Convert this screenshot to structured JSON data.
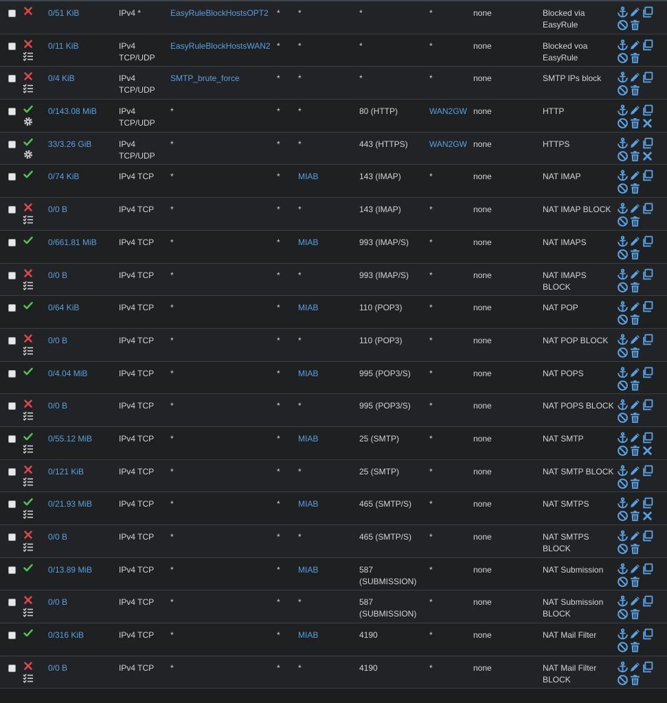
{
  "colors": {
    "link": "#5aa0e0",
    "pass": "#4fc44f",
    "block": "#e04848",
    "icon": "#5aa0e0"
  },
  "rules": [
    {
      "action": "block",
      "sub": "",
      "states": "0/51 KiB",
      "protocol": "IPv4 *",
      "source": "EasyRuleBlockHostsOPT2",
      "source_port": "*",
      "destination": "*",
      "dest_port": "*",
      "gateway": "*",
      "queue": "none",
      "description": "Blocked via EasyRule",
      "extra_x": false
    },
    {
      "action": "block",
      "sub": "list",
      "states": "0/11 KiB",
      "protocol": "IPv4 TCP/UDP",
      "source": "EasyRuleBlockHostsWAN2",
      "source_port": "*",
      "destination": "*",
      "dest_port": "*",
      "gateway": "*",
      "queue": "none",
      "description": "Blocked voa EasyRule",
      "extra_x": false
    },
    {
      "action": "block",
      "sub": "list",
      "states": "0/4 KiB",
      "protocol": "IPv4 TCP/UDP",
      "source": "SMTP_brute_force",
      "source_port": "*",
      "destination": "*",
      "dest_port": "*",
      "gateway": "*",
      "queue": "none",
      "description": "SMTP IPs block",
      "extra_x": false
    },
    {
      "action": "pass",
      "sub": "gear",
      "states": "0/143.08 MiB",
      "protocol": "IPv4 TCP/UDP",
      "source": "*",
      "source_port": "*",
      "destination": "*",
      "dest_port": "80 (HTTP)",
      "gateway": "WAN2GW",
      "queue": "none",
      "description": "HTTP",
      "extra_x": true
    },
    {
      "action": "pass",
      "sub": "gear",
      "states": "33/3.26 GiB",
      "protocol": "IPv4 TCP/UDP",
      "source": "*",
      "source_port": "*",
      "destination": "*",
      "dest_port": "443 (HTTPS)",
      "gateway": "WAN2GW",
      "queue": "none",
      "description": "HTTPS",
      "extra_x": true
    },
    {
      "action": "pass",
      "sub": "",
      "states": "0/74 KiB",
      "protocol": "IPv4 TCP",
      "source": "*",
      "source_port": "*",
      "destination": "MIAB",
      "dest_port": "143 (IMAP)",
      "gateway": "*",
      "queue": "none",
      "description": "NAT IMAP",
      "extra_x": false
    },
    {
      "action": "block",
      "sub": "list",
      "states": "0/0 B",
      "protocol": "IPv4 TCP",
      "source": "*",
      "source_port": "*",
      "destination": "*",
      "dest_port": "143 (IMAP)",
      "gateway": "*",
      "queue": "none",
      "description": "NAT IMAP BLOCK",
      "extra_x": false
    },
    {
      "action": "pass",
      "sub": "",
      "states": "0/661.81 MiB",
      "protocol": "IPv4 TCP",
      "source": "*",
      "source_port": "*",
      "destination": "MIAB",
      "dest_port": "993 (IMAP/S)",
      "gateway": "*",
      "queue": "none",
      "description": "NAT IMAPS",
      "extra_x": false
    },
    {
      "action": "block",
      "sub": "list",
      "states": "0/0 B",
      "protocol": "IPv4 TCP",
      "source": "*",
      "source_port": "*",
      "destination": "*",
      "dest_port": "993 (IMAP/S)",
      "gateway": "*",
      "queue": "none",
      "description": "NAT IMAPS BLOCK",
      "extra_x": false
    },
    {
      "action": "pass",
      "sub": "",
      "states": "0/64 KiB",
      "protocol": "IPv4 TCP",
      "source": "*",
      "source_port": "*",
      "destination": "MIAB",
      "dest_port": "110 (POP3)",
      "gateway": "*",
      "queue": "none",
      "description": "NAT POP",
      "extra_x": false
    },
    {
      "action": "block",
      "sub": "list",
      "states": "0/0 B",
      "protocol": "IPv4 TCP",
      "source": "*",
      "source_port": "*",
      "destination": "*",
      "dest_port": "110 (POP3)",
      "gateway": "*",
      "queue": "none",
      "description": "NAT POP BLOCK",
      "extra_x": false
    },
    {
      "action": "pass",
      "sub": "",
      "states": "0/4.04 MiB",
      "protocol": "IPv4 TCP",
      "source": "*",
      "source_port": "*",
      "destination": "MIAB",
      "dest_port": "995 (POP3/S)",
      "gateway": "*",
      "queue": "none",
      "description": "NAT POPS",
      "extra_x": false
    },
    {
      "action": "block",
      "sub": "list",
      "states": "0/0 B",
      "protocol": "IPv4 TCP",
      "source": "*",
      "source_port": "*",
      "destination": "*",
      "dest_port": "995 (POP3/S)",
      "gateway": "*",
      "queue": "none",
      "description": "NAT POPS BLOCK",
      "extra_x": false
    },
    {
      "action": "pass",
      "sub": "list",
      "states": "0/55.12 MiB",
      "protocol": "IPv4 TCP",
      "source": "*",
      "source_port": "*",
      "destination": "MIAB",
      "dest_port": "25 (SMTP)",
      "gateway": "*",
      "queue": "none",
      "description": "NAT SMTP",
      "extra_x": true
    },
    {
      "action": "block",
      "sub": "list",
      "states": "0/121 KiB",
      "protocol": "IPv4 TCP",
      "source": "*",
      "source_port": "*",
      "destination": "*",
      "dest_port": "25 (SMTP)",
      "gateway": "*",
      "queue": "none",
      "description": "NAT SMTP BLOCK",
      "extra_x": false
    },
    {
      "action": "pass",
      "sub": "list",
      "states": "0/21.93 MiB",
      "protocol": "IPv4 TCP",
      "source": "*",
      "source_port": "*",
      "destination": "MIAB",
      "dest_port": "465 (SMTP/S)",
      "gateway": "*",
      "queue": "none",
      "description": "NAT SMTPS",
      "extra_x": true
    },
    {
      "action": "block",
      "sub": "list",
      "states": "0/0 B",
      "protocol": "IPv4 TCP",
      "source": "*",
      "source_port": "*",
      "destination": "*",
      "dest_port": "465 (SMTP/S)",
      "gateway": "*",
      "queue": "none",
      "description": "NAT SMTPS BLOCK",
      "extra_x": false
    },
    {
      "action": "pass",
      "sub": "",
      "states": "0/13.89 MiB",
      "protocol": "IPv4 TCP",
      "source": "*",
      "source_port": "*",
      "destination": "MIAB",
      "dest_port": "587 (SUBMISSION)",
      "gateway": "*",
      "queue": "none",
      "description": "NAT Submission",
      "extra_x": false
    },
    {
      "action": "block",
      "sub": "list",
      "states": "0/0 B",
      "protocol": "IPv4 TCP",
      "source": "*",
      "source_port": "*",
      "destination": "*",
      "dest_port": "587 (SUBMISSION)",
      "gateway": "*",
      "queue": "none",
      "description": "NAT Submission BLOCK",
      "extra_x": false
    },
    {
      "action": "pass",
      "sub": "",
      "states": "0/316 KiB",
      "protocol": "IPv4 TCP",
      "source": "*",
      "source_port": "*",
      "destination": "MIAB",
      "dest_port": "4190",
      "gateway": "*",
      "queue": "none",
      "description": "NAT Mail Filter",
      "extra_x": false
    },
    {
      "action": "block",
      "sub": "list",
      "states": "0/0 B",
      "protocol": "IPv4 TCP",
      "source": "*",
      "source_port": "*",
      "destination": "*",
      "dest_port": "4190",
      "gateway": "*",
      "queue": "none",
      "description": "NAT Mail Filter BLOCK",
      "extra_x": false
    }
  ]
}
